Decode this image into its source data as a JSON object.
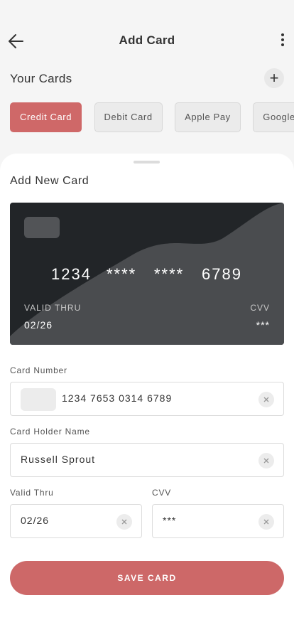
{
  "header": {
    "title": "Add Card",
    "icons": {
      "back": "arrow-left-icon",
      "more": "more-vertical-icon"
    }
  },
  "your_cards": {
    "title": "Your Cards",
    "add_icon": "plus-icon",
    "add_glyph": "+",
    "tabs": [
      {
        "label": "Credit Card",
        "active": true
      },
      {
        "label": "Debit Card",
        "active": false
      },
      {
        "label": "Apple Pay",
        "active": false
      },
      {
        "label": "Google Pay",
        "active": false
      }
    ]
  },
  "sheet": {
    "title": "Add New Card",
    "card_preview": {
      "groups": [
        "1234",
        "****",
        "****",
        "6789"
      ],
      "valid_label": "VALID THRU",
      "valid_value": "02/26",
      "cvv_label": "CVV",
      "cvv_value": "***"
    },
    "form": {
      "card_number": {
        "label": "Card Number",
        "value": "1234 7653 0314 6789"
      },
      "holder_name": {
        "label": "Card Holder Name",
        "value": "Russell Sprout"
      },
      "valid_thru": {
        "label": "Valid Thru",
        "value": "02/26"
      },
      "cvv": {
        "label": "CVV",
        "value": "***"
      }
    },
    "save_label": "SAVE CARD"
  },
  "colors": {
    "accent": "#cd6868",
    "card_bg": "#222528",
    "card_wave": "#4a4c4f",
    "screen_bg": "#f5f5f5"
  }
}
